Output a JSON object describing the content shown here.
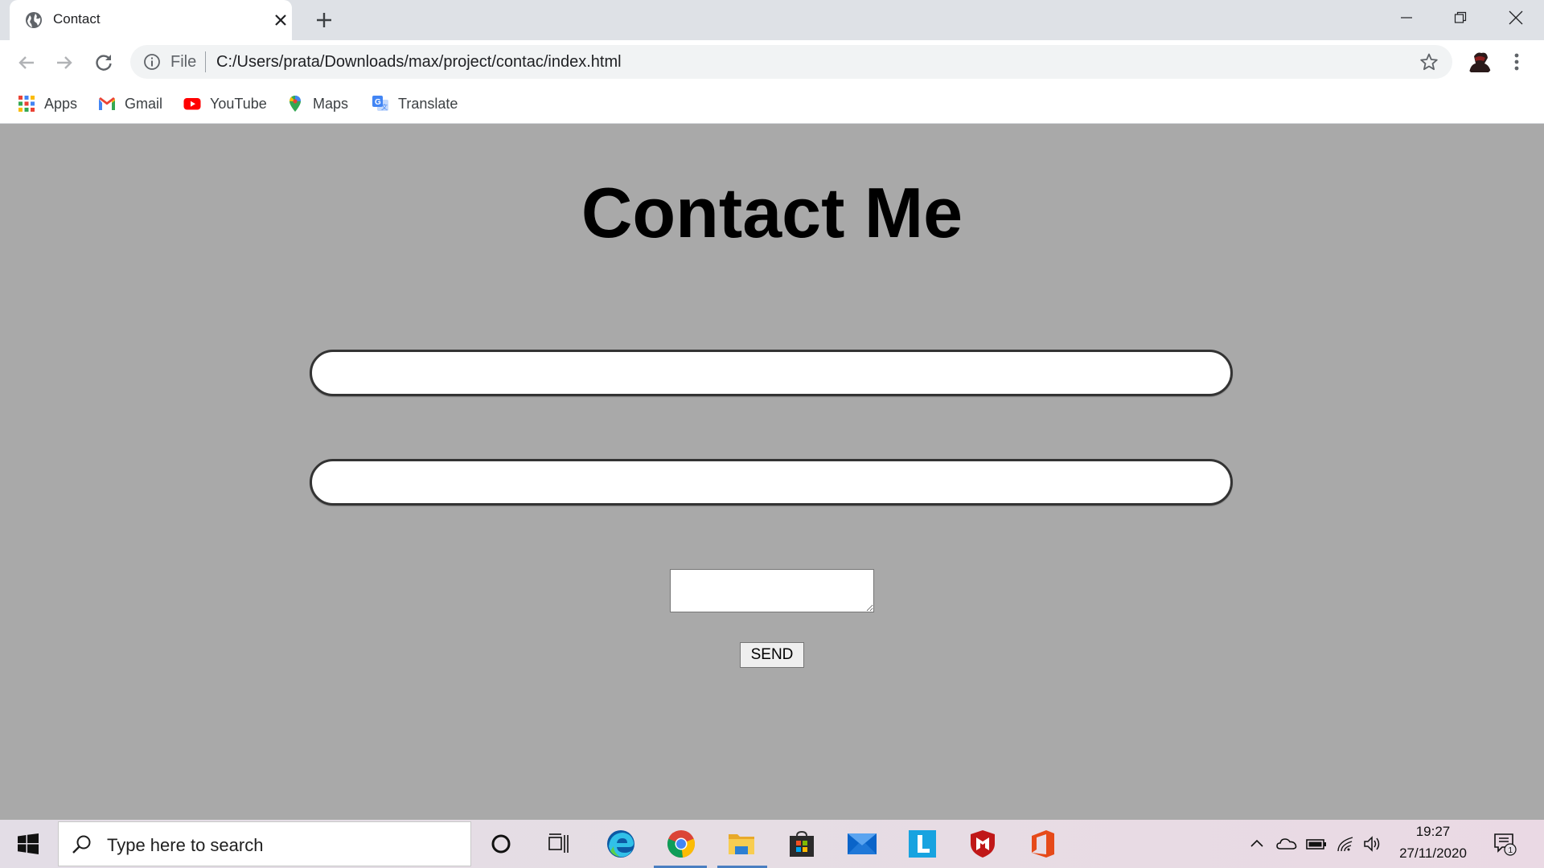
{
  "browser": {
    "tab_title": "Contact",
    "omnibox": {
      "scheme_label": "File",
      "url": "C:/Users/prata/Downloads/max/project/contac/index.html"
    },
    "bookmarks": [
      {
        "label": "Apps",
        "icon": "apps-grid-icon"
      },
      {
        "label": "Gmail",
        "icon": "gmail-icon"
      },
      {
        "label": "YouTube",
        "icon": "youtube-icon"
      },
      {
        "label": "Maps",
        "icon": "maps-pin-icon"
      },
      {
        "label": "Translate",
        "icon": "translate-icon"
      }
    ]
  },
  "page": {
    "heading": "Contact Me",
    "name_field": {
      "value": "",
      "placeholder": ""
    },
    "email_field": {
      "value": "",
      "placeholder": ""
    },
    "message_field": {
      "value": ""
    },
    "send_label": "SEND",
    "background_color": "#a9a9a9"
  },
  "taskbar": {
    "search_placeholder": "Type here to search",
    "pinned_apps": [
      "cortana-icon",
      "task-view-icon",
      "edge-icon",
      "chrome-icon",
      "file-explorer-icon",
      "microsoft-store-icon",
      "mail-icon",
      "l-app-icon",
      "mcafee-icon",
      "office-icon"
    ],
    "clock": {
      "time": "19:27",
      "date": "27/11/2020"
    },
    "notification_count": "1"
  }
}
